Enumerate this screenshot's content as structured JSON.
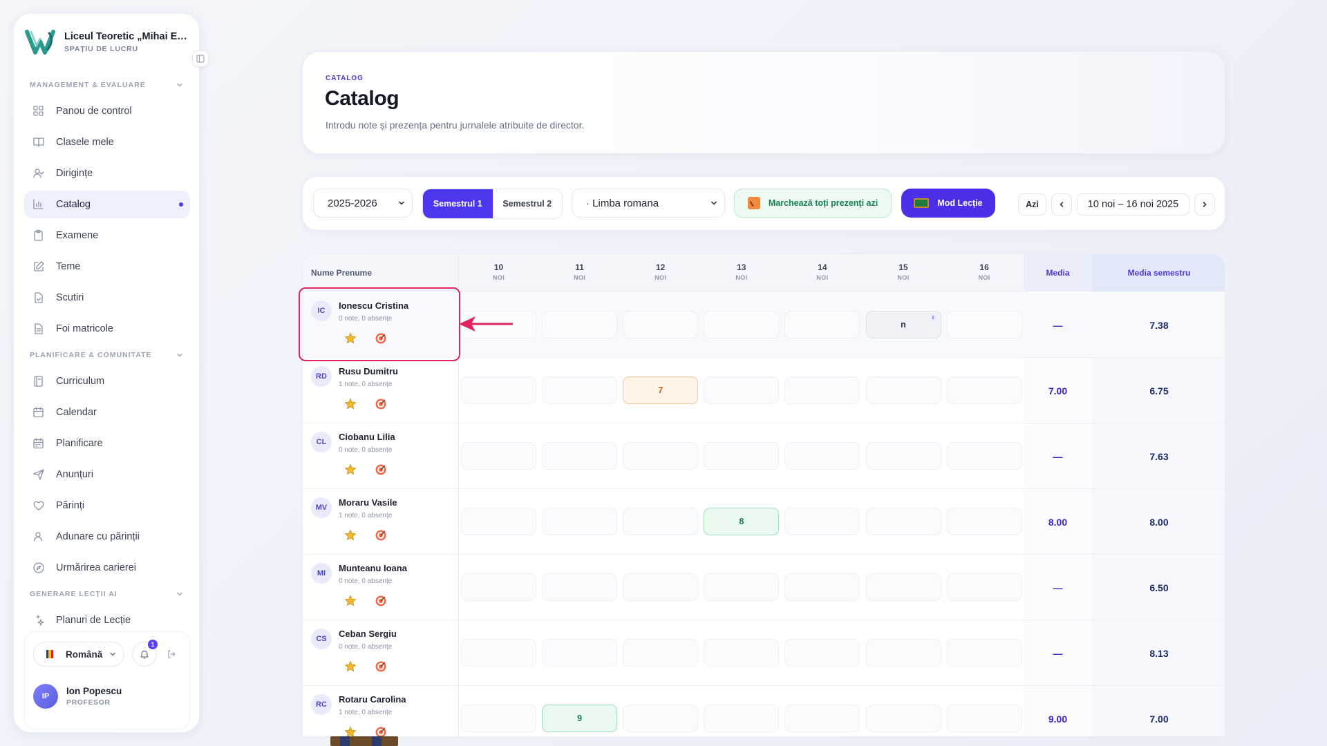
{
  "colors": {
    "accent": "#4c36ee",
    "green": "#178050",
    "highlight": "#e0245e"
  },
  "sidebar": {
    "school_name": "Liceul Teoretic „Mihai Emi...",
    "workspace_label": "SPAȚIU DE LUCRU",
    "sections": [
      {
        "title": "MANAGEMENT & EVALUARE",
        "items": [
          {
            "label": "Panou de control",
            "icon": "grid-icon"
          },
          {
            "label": "Clasele mele",
            "icon": "book-icon"
          },
          {
            "label": "Dirigințe",
            "icon": "user-check-icon"
          },
          {
            "label": "Catalog",
            "icon": "bar-chart-icon",
            "active": true
          },
          {
            "label": "Examene",
            "icon": "clipboard-icon"
          },
          {
            "label": "Teme",
            "icon": "edit-icon"
          },
          {
            "label": "Scutiri",
            "icon": "file-check-icon"
          },
          {
            "label": "Foi matricole",
            "icon": "file-text-icon"
          }
        ]
      },
      {
        "title": "PLANIFICARE & COMUNITATE",
        "items": [
          {
            "label": "Curriculum",
            "icon": "book-stack-icon"
          },
          {
            "label": "Calendar",
            "icon": "calendar-icon"
          },
          {
            "label": "Planificare",
            "icon": "calendar-plan-icon"
          },
          {
            "label": "Anunțuri",
            "icon": "send-icon"
          },
          {
            "label": "Părinți",
            "icon": "heart-icon"
          },
          {
            "label": "Adunare cu părinții",
            "icon": "users-icon"
          },
          {
            "label": "Urmărirea carierei",
            "icon": "compass-icon"
          }
        ]
      },
      {
        "title": "GENERARE LECȚII AI",
        "items": [
          {
            "label": "Planuri de Lecție",
            "icon": "sparkle-icon"
          }
        ]
      }
    ],
    "language": "Română",
    "notifications_count": "1",
    "user": {
      "initials": "IP",
      "name": "Ion Popescu",
      "role": "PROFESOR"
    }
  },
  "header": {
    "eyebrow": "CATALOG",
    "title": "Catalog",
    "subtitle": "Introdu note și prezența pentru jurnalele atribuite de director."
  },
  "toolbar": {
    "year": "2025-2026",
    "semester1": "Semestrul 1",
    "semester2": "Semestrul 2",
    "subject": "· Limba romana",
    "mark_present": "Marchează toți prezenți azi",
    "lesson_mode": "Mod Lecție",
    "today": "Azi",
    "date_range": "10 noi – 16 noi 2025"
  },
  "table": {
    "name_header": "Nume Prenume",
    "media_header": "Media",
    "semester_media_header": "Media semestru",
    "days": [
      {
        "day": "10",
        "month": "NOI"
      },
      {
        "day": "11",
        "month": "NOI"
      },
      {
        "day": "12",
        "month": "NOI"
      },
      {
        "day": "13",
        "month": "NOI"
      },
      {
        "day": "14",
        "month": "NOI"
      },
      {
        "day": "15",
        "month": "NOI"
      },
      {
        "day": "16",
        "month": "NOI"
      }
    ],
    "students": [
      {
        "initials": "IC",
        "name": "Ionescu Cristina",
        "stats": "0 note, 0 absențe",
        "cells": [
          "",
          "",
          "",
          "",
          "",
          "n",
          ""
        ],
        "media": "—",
        "semester_media": "7.38"
      },
      {
        "initials": "RD",
        "name": "Rusu Dumitru",
        "stats": "1 note, 0 absențe",
        "cells": [
          "",
          "",
          "7",
          "",
          "",
          "",
          ""
        ],
        "media": "7.00",
        "semester_media": "6.75"
      },
      {
        "initials": "CL",
        "name": "Ciobanu Lilia",
        "stats": "0 note, 0 absențe",
        "cells": [
          "",
          "",
          "",
          "",
          "",
          "",
          ""
        ],
        "media": "—",
        "semester_media": "7.63"
      },
      {
        "initials": "MV",
        "name": "Moraru Vasile",
        "stats": "1 note, 0 absențe",
        "cells": [
          "",
          "",
          "",
          "8",
          "",
          "",
          ""
        ],
        "media": "8.00",
        "semester_media": "8.00"
      },
      {
        "initials": "MI",
        "name": "Munteanu Ioana",
        "stats": "0 note, 0 absențe",
        "cells": [
          "",
          "",
          "",
          "",
          "",
          "",
          ""
        ],
        "media": "—",
        "semester_media": "6.50"
      },
      {
        "initials": "CS",
        "name": "Ceban Sergiu",
        "stats": "0 note, 0 absențe",
        "cells": [
          "",
          "",
          "",
          "",
          "",
          "",
          ""
        ],
        "media": "—",
        "semester_media": "8.13"
      },
      {
        "initials": "RC",
        "name": "Rotaru Carolina",
        "stats": "1 note, 0 absențe",
        "cells": [
          "",
          "9",
          "",
          "",
          "",
          "",
          ""
        ],
        "media": "9.00",
        "semester_media": "7.00"
      }
    ]
  }
}
